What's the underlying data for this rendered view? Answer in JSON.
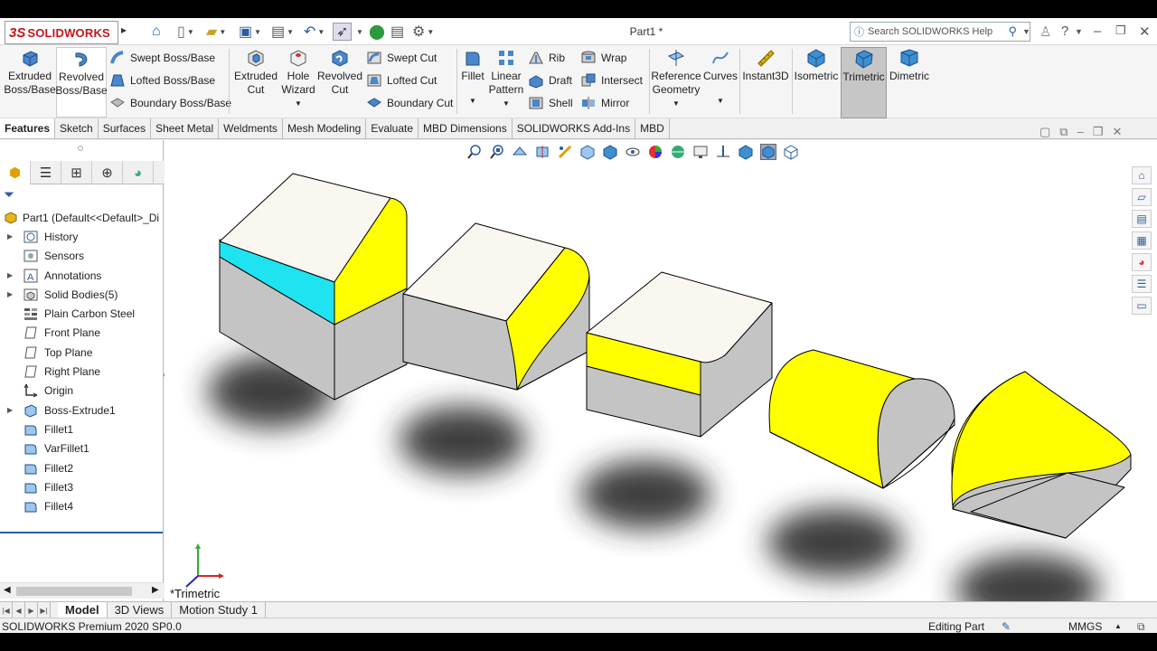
{
  "title_bar": {
    "app_name": "SOLIDWORKS",
    "document_title": "Part1 *",
    "search_placeholder": "Search SOLIDWORKS Help",
    "help_label": "?"
  },
  "ribbon": {
    "extruded_boss": "Extruded Boss/Base",
    "revolved_boss": "Revolved Boss/Base",
    "swept_boss": "Swept Boss/Base",
    "lofted_boss": "Lofted Boss/Base",
    "boundary_boss": "Boundary Boss/Base",
    "extruded_cut": "Extruded Cut",
    "hole_wizard": "Hole Wizard",
    "revolved_cut": "Revolved Cut",
    "swept_cut": "Swept Cut",
    "lofted_cut": "Lofted Cut",
    "boundary_cut": "Boundary Cut",
    "fillet": "Fillet",
    "linear_pattern": "Linear Pattern",
    "rib": "Rib",
    "draft": "Draft",
    "shell": "Shell",
    "wrap": "Wrap",
    "intersect": "Intersect",
    "mirror": "Mirror",
    "reference_geometry": "Reference Geometry",
    "curves": "Curves",
    "instant3d": "Instant3D",
    "isometric": "Isometric",
    "trimetric": "Trimetric",
    "dimetric": "Dimetric"
  },
  "command_tabs": [
    "Features",
    "Sketch",
    "Surfaces",
    "Sheet Metal",
    "Weldments",
    "Mesh Modeling",
    "Evaluate",
    "MBD Dimensions",
    "SOLIDWORKS Add-Ins",
    "MBD"
  ],
  "tree": {
    "root": "Part1  (Default<<Default>_Di",
    "items": [
      "History",
      "Sensors",
      "Annotations",
      "Solid Bodies(5)",
      "Plain Carbon Steel",
      "Front Plane",
      "Top Plane",
      "Right Plane",
      "Origin",
      "Boss-Extrude1",
      "Fillet1",
      "VarFillet1",
      "Fillet2",
      "Fillet3",
      "Fillet4"
    ]
  },
  "viewport": {
    "view_name": "*Trimetric",
    "colors": {
      "face": "#faf6f0",
      "side": "#c4c4c4",
      "fillet_yellow": "#ffff00",
      "fillet_cyan": "#1fe3f0"
    }
  },
  "bottom_tabs": [
    "Model",
    "3D Views",
    "Motion Study 1"
  ],
  "status": {
    "product": "SOLIDWORKS Premium 2020 SP0.0",
    "mode": "Editing Part",
    "units": "MMGS"
  }
}
